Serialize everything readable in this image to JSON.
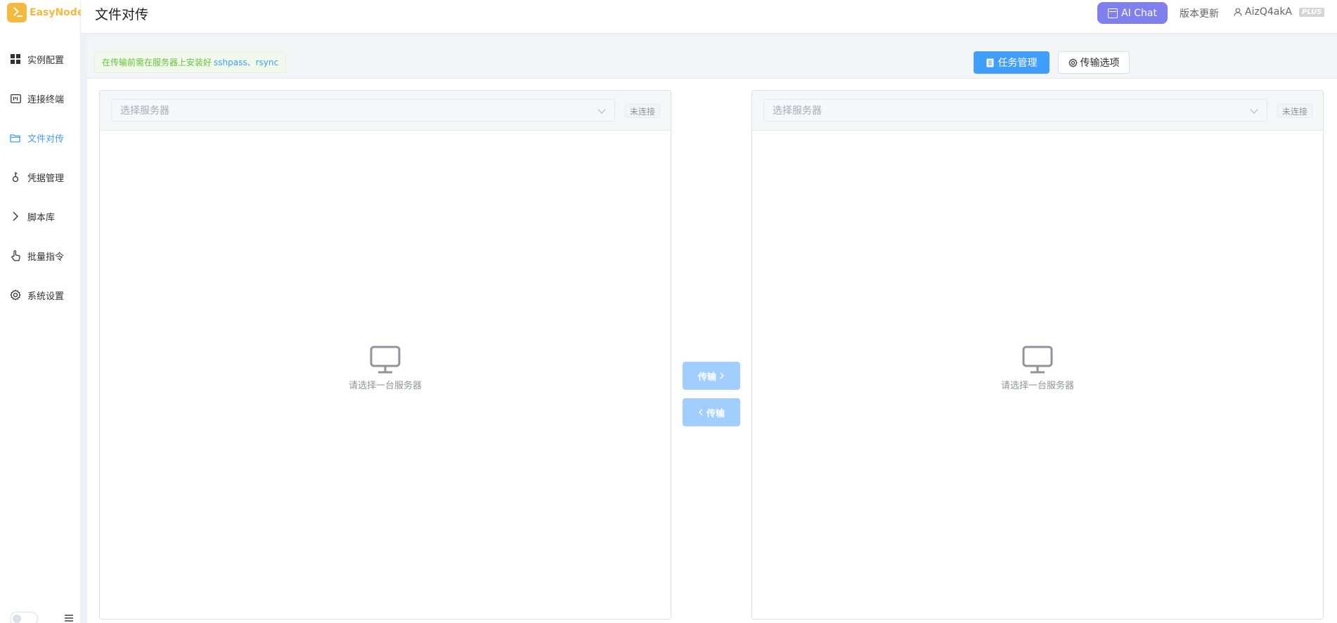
{
  "app": {
    "name": "EasyNode",
    "brand_color": "#f5b940"
  },
  "header": {
    "title": "文件对传",
    "ai_chat_label": "AI Chat",
    "update_label": "版本更新",
    "username": "AizQ4akA",
    "plan_badge": "PLUS",
    "ai_color": "#7f7ff0"
  },
  "sidebar": {
    "items": [
      {
        "label": "实例配置",
        "icon": "grid-icon"
      },
      {
        "label": "连接终端",
        "icon": "terminal-icon"
      },
      {
        "label": "文件对传",
        "icon": "folder-icon",
        "active": true
      },
      {
        "label": "凭据管理",
        "icon": "key-icon"
      },
      {
        "label": "脚本库",
        "icon": "chevron-right-icon"
      },
      {
        "label": "批量指令",
        "icon": "pointer-icon"
      },
      {
        "label": "系统设置",
        "icon": "gear-icon"
      }
    ]
  },
  "toolbar": {
    "tip_text": "在传输前需在服务器上安装好",
    "tip_links": "sshpass、rsync",
    "task_button": "任务管理",
    "options_button": "传输选项",
    "primary_color": "#409eff"
  },
  "left_panel": {
    "select_placeholder": "选择服务器",
    "status": "未连接",
    "empty_text": "请选择一台服务器"
  },
  "right_panel": {
    "select_placeholder": "选择服务器",
    "status": "未连接",
    "empty_text": "请选择一台服务器"
  },
  "transfer": {
    "to_right_label": "传输",
    "to_left_label": "传输"
  }
}
